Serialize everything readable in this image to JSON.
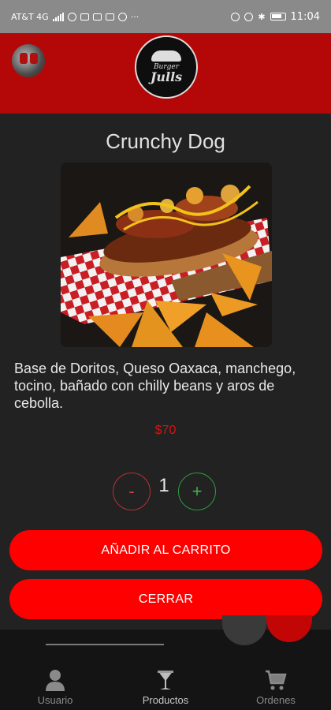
{
  "status_bar": {
    "carrier": "AT&T 4G",
    "time": "11:04",
    "icons": [
      "signal-icon",
      "whatsapp-icon",
      "mail-icon",
      "mail-icon",
      "mail-icon",
      "facebook-icon",
      "more-icon",
      "alarm-icon",
      "mute-icon",
      "bluetooth-icon",
      "battery-icon"
    ]
  },
  "header": {
    "logo_top": "Burger",
    "logo_bottom": "Julls"
  },
  "product": {
    "title": "Crunchy Dog",
    "description": "Base de Doritos, Queso Oaxaca, manchego, tocino, bañado con chilly beans y aros de cebolla.",
    "price": "$70"
  },
  "quantity": {
    "minus_label": "-",
    "value": "1",
    "plus_label": "+"
  },
  "actions": {
    "add_label": "AÑADIR AL CARRITO",
    "close_label": "CERRAR"
  },
  "bottom_nav": {
    "items": [
      {
        "label": "Usuario",
        "icon": "user-icon"
      },
      {
        "label": "Productos",
        "icon": "glass-icon"
      },
      {
        "label": "Ordenes",
        "icon": "cart-icon"
      }
    ]
  },
  "colors": {
    "header_red": "#b40808",
    "button_red": "#ff0000",
    "price_red": "#d21515",
    "plus_green": "#2f9a3d",
    "modal_bg": "#222222"
  }
}
